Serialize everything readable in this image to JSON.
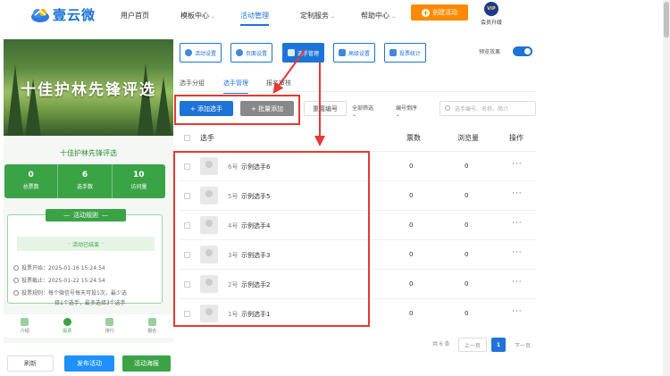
{
  "brand": {
    "name": "壹云微"
  },
  "nav": {
    "items": [
      "用户首页",
      "模板中心",
      "活动管理",
      "定制服务",
      "帮助中心"
    ],
    "active_index": 2,
    "create_label": "创建活动",
    "vip_badge": "VIP",
    "vip_label": "会员升级"
  },
  "preview": {
    "banner_title": "十佳护林先锋评选",
    "title": "十佳护林先锋评选",
    "stats": [
      {
        "value": "0",
        "label": "总票数"
      },
      {
        "value": "6",
        "label": "选手数"
      },
      {
        "value": "10",
        "label": "访问量"
      }
    ],
    "rules_title": "活动规则",
    "rules_status": "活动已结束",
    "rules": [
      "投票开始：2025-01-16 15:24:54",
      "投票截止：2025-01-22 15:24:54",
      "投票规则：每个微信号每天可投1次，最少选",
      "择1个选手，最多选择3个选手"
    ],
    "tabs": [
      "介绍",
      "投票",
      "排行",
      "报名"
    ],
    "active_tab": 1,
    "buttons": {
      "refresh": "刷新",
      "publish": "发布活动",
      "poster": "活动海报"
    }
  },
  "toolbar": {
    "buttons": [
      "活动设置",
      "页面设置",
      "选手管理",
      "高级设置",
      "投票统计"
    ],
    "active_index": 2,
    "preview_label": "预览效果",
    "preview_on": true
  },
  "subtabs": {
    "items": [
      "选手分组",
      "选手管理",
      "报名审核"
    ],
    "active_index": 1
  },
  "actions": {
    "add_label": "+ 添加选手",
    "batch_label": "+ 批量添加",
    "renumber_label": "重置编号",
    "filter_all": "全部筛选",
    "filter_order": "编号倒序",
    "search_placeholder": "选手编号、名称、简介"
  },
  "table": {
    "columns": {
      "player": "选手",
      "votes": "票数",
      "views": "浏览量",
      "ops": "操作"
    },
    "rows": [
      {
        "num": "6号",
        "name": "示例选手6",
        "votes": "0",
        "views": "0",
        "ops": "···"
      },
      {
        "num": "5号",
        "name": "示例选手5",
        "votes": "0",
        "views": "0",
        "ops": "···"
      },
      {
        "num": "4号",
        "name": "示例选手4",
        "votes": "0",
        "views": "0",
        "ops": "···"
      },
      {
        "num": "3号",
        "name": "示例选手3",
        "votes": "0",
        "views": "0",
        "ops": "···"
      },
      {
        "num": "2号",
        "name": "示例选手2",
        "votes": "0",
        "views": "0",
        "ops": "···"
      },
      {
        "num": "1号",
        "name": "示例选手1",
        "votes": "0",
        "views": "0",
        "ops": "···"
      }
    ]
  },
  "pagination": {
    "total": "共 6 条",
    "prev": "上一页",
    "current": "1",
    "next": "下一页"
  },
  "colors": {
    "primary": "#1e73d8",
    "orange": "#ff8a00",
    "green": "#3aa346",
    "annotation": "#e53935"
  }
}
